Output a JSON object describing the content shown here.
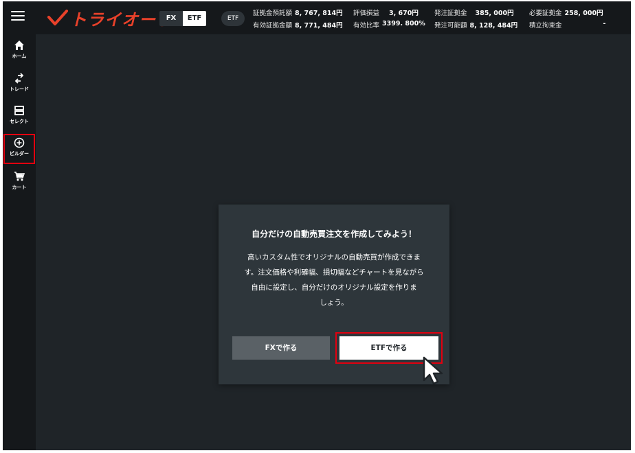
{
  "header": {
    "logo_text": "トライオート",
    "segment": {
      "fx": "FX",
      "etf": "ETF"
    },
    "etf_pill": "ETF",
    "stats": [
      [
        {
          "label": "証拠金預託額",
          "value": "8, 767, 814円"
        },
        {
          "label": "評価損益",
          "value": "3, 670円"
        },
        {
          "label": "発注証拠金",
          "value": "385, 000円"
        },
        {
          "label": "必要証拠金",
          "value": "258, 000円"
        }
      ],
      [
        {
          "label": "有効証拠金額",
          "value": "8, 771, 484円"
        },
        {
          "label": "有効比率",
          "value": "3399. 800%"
        },
        {
          "label": "発注可能額",
          "value": "8, 128, 484円"
        },
        {
          "label": "積立拘束金",
          "value": "-"
        }
      ]
    ]
  },
  "sidebar": {
    "items": [
      {
        "label": "ホーム",
        "icon": "home-icon"
      },
      {
        "label": "トレード",
        "icon": "trade-arrows-icon"
      },
      {
        "label": "セレクト",
        "icon": "select-icon"
      },
      {
        "label": "ビルダー",
        "icon": "plus-circle-icon",
        "active": true
      },
      {
        "label": "カート",
        "icon": "cart-icon"
      }
    ]
  },
  "modal": {
    "title": "自分だけの自動売買注文を作成してみよう！",
    "body_lines": [
      "高いカスタム性でオリジナルの自動売買が作成できま",
      "す。注文価格や利確幅、損切幅などチャートを見ながら",
      "自由に設定し、自分だけのオリジナル設定を作りま",
      "しょう。"
    ],
    "fx_button": "FXで作る",
    "etf_button": "ETFで作る"
  },
  "colors": {
    "brand": "#e8412a",
    "highlight": "#e3000f",
    "background": "#1f2428",
    "bar": "#15181b",
    "modal": "#2e363b"
  }
}
